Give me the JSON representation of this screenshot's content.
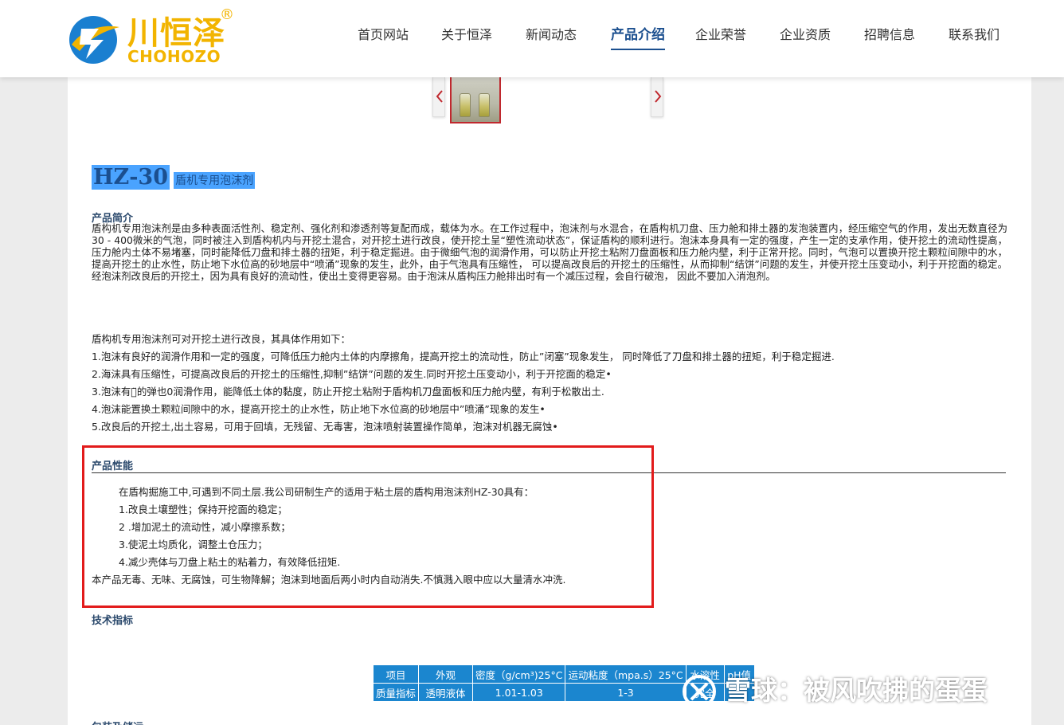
{
  "brand": {
    "name_cn": "川恒泽",
    "name_en": "CHOHOZO",
    "reg": "®"
  },
  "nav": [
    {
      "label": "首页网站",
      "active": false
    },
    {
      "label": "关于恒泽",
      "active": false
    },
    {
      "label": "新闻动态",
      "active": false
    },
    {
      "label": "产品介绍",
      "active": true
    },
    {
      "label": "企业荣誉",
      "active": false
    },
    {
      "label": "企业资质",
      "active": false
    },
    {
      "label": "招聘信息",
      "active": false
    },
    {
      "label": "联系我们",
      "active": false
    }
  ],
  "product": {
    "code": "HZ-30",
    "name": "盾机专用泡沫剂"
  },
  "intro": {
    "heading": "产品简介",
    "text": "盾构机专用泡沫剂是由多种表面活性剂、稳定剂、强化剂和渗透剂等复配而成，载体为水。在工作过程中，泡沫剂与水混合，在盾构机刀盘、压力舱和排土器的发泡装置内，经压缩空气的作用，发出无数直径为30 - 400微米的气泡，同时被注入到盾构机内与开挖土混合，对开挖土进行改良，使开挖土呈“塑性流动状态”，保证盾构的顺利进行。泡沫本身具有一定的强度，产生一定的支承作用，使开挖土的流动性提高，压力舱内土体不易堵塞，同时能降低刀盘和排土器的扭矩，利于稳定掘进。由于微细气泡的润滑作用，可以防止开挖土粘附刀盘面板和压力舱内壁，利于正常开挖。同时，气泡可以置换开挖土颗粒间隙中的水，提高开挖土的止水性，防止地下水位高的砂地层中“喷涌”现象的发生，此外，由于气泡具有压缩性， 可以提高改良后的开挖土的压缩性，从而抑制“结饼”问题的发生，并使开挖土压变动小，利于开挖面的稳定。经泡沫剂改良后的开挖土，因为具有良好的流动性，使出土变得更容易。由于泡沫从盾构压力舱排出时有一个减压过程，会自行破泡， 因此不要加入消泡剂。"
  },
  "effects": {
    "lead": "盾构机专用泡沫剂可对开挖土进行改良，其具体作用如下：",
    "items": [
      "1.泡沫有良好的润滑作用和一定的强度，可降低压力舱内土体的内摩擦角，提高开挖土的流动性，防止”闭塞”现象发生， 同时降低了刀盘和排土器的扭矩，利于稳定掘进.",
      "2.海沫具有压缩性，可提高改良后的开挖土的压缩性,抑制”结饼”问题的发生.同时开挖土压变动小，利于开挖面的稳定•",
      "3.泡沫有一̈的弹也0润滑作用，能降低土体的黏度，防止开挖土粘附于盾构机刀盘面板和压力舱内壁，有利于松散出土.",
      "4.泡沫能置换土颗粒间隙中的水，提高开挖土的止水性，防止地下水位高的砂地层中”喷涌”现象的发生•",
      "5.改良后的开挖土,出土容易，可用于回填，无残留、无毒害，泡沫喷射装置操作简单，泡沫对机器无腐蚀•"
    ]
  },
  "performance": {
    "heading": "产品性能",
    "lead": "在盾构掘施工中,可遇到不同土层.我公司研制生产的适用于粘土层的盾构用泡沫剂HZ-30具有：",
    "items": [
      "1.改良土壤塑性；保持开挖面的稳定；",
      "2 .增加泥土的流动性，减小摩擦系数；",
      "3.使泥土均质化，调整土仓压力；",
      "4.减少壳体与刀盘上粘土的粘着力，有效降低扭矩."
    ],
    "note": "本产品无毒、无味、无腐蚀，可生物降解；泡沫到地面后两小时内自动消失.不慎溅入眼中应以大量清水冲洗."
  },
  "spec": {
    "heading": "技术指标",
    "headers": [
      "项目",
      "外观",
      "密度（g/cm³)25°C",
      "运动粘度（mpa.s）25°C",
      "水溶性",
      "pH值"
    ],
    "row": [
      "质量指标",
      "透明液体",
      "1.01-1.03",
      "1-3",
      "完全",
      ""
    ]
  },
  "next_heading": "包装及储运",
  "watermark": "雪球：被风吹拂的蛋蛋",
  "colors": {
    "accent": "#1b4f8f",
    "highlight_box": "#e21b1b",
    "table_blue": "#1b86cf",
    "logo_yellow": "#f2b400"
  }
}
